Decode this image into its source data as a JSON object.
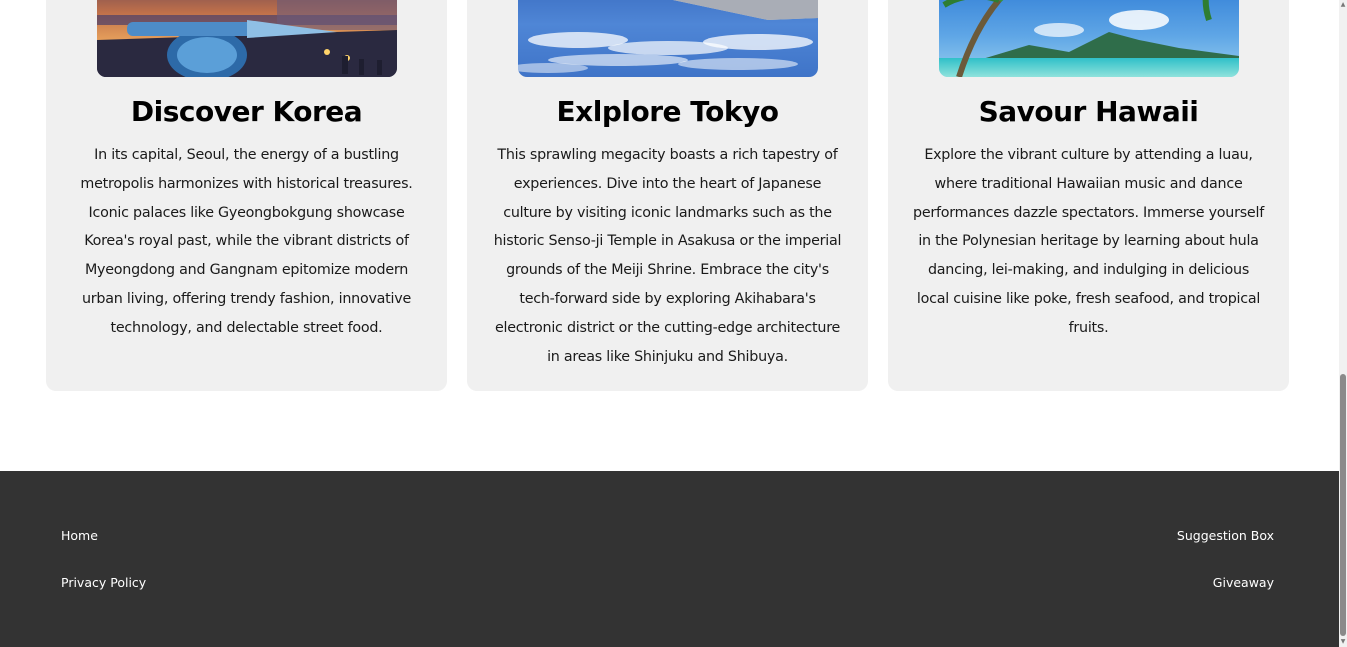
{
  "cards": [
    {
      "title": "Discover Korea",
      "text": "In its capital, Seoul, the energy of a bustling metropolis harmonizes with historical treasures. Iconic palaces like Gyeongbokgung showcase Korea's royal past, while the vibrant districts of Myeongdong and Gangnam epitomize modern urban living, offering trendy fashion, innovative technology, and delectable street food.",
      "image": "airport-tarmac-photo"
    },
    {
      "title": "Exlplore Tokyo",
      "text": "This sprawling megacity boasts a rich tapestry of experiences. Dive into the heart of Japanese culture by visiting iconic landmarks such as the historic Senso-ji Temple in Asakusa or the imperial grounds of the Meiji Shrine. Embrace the city's tech-forward side by exploring Akihabara's electronic district or the cutting-edge architecture in areas like Shinjuku and Shibuya.",
      "image": "airplane-wing-clouds-photo"
    },
    {
      "title": "Savour Hawaii",
      "text": "Explore the vibrant culture by attending a luau, where traditional Hawaiian music and dance performances dazzle spectators. Immerse yourself in the Polynesian heritage by learning about hula dancing, lei-making, and indulging in delicious local cuisine like poke, fresh seafood, and tropical fruits.",
      "image": "tropical-beach-palm-photo"
    }
  ],
  "footer": {
    "links_left": [
      "Home",
      "Privacy Policy"
    ],
    "links_right": [
      "Suggestion Box",
      "Giveaway"
    ],
    "background": "#333333"
  }
}
